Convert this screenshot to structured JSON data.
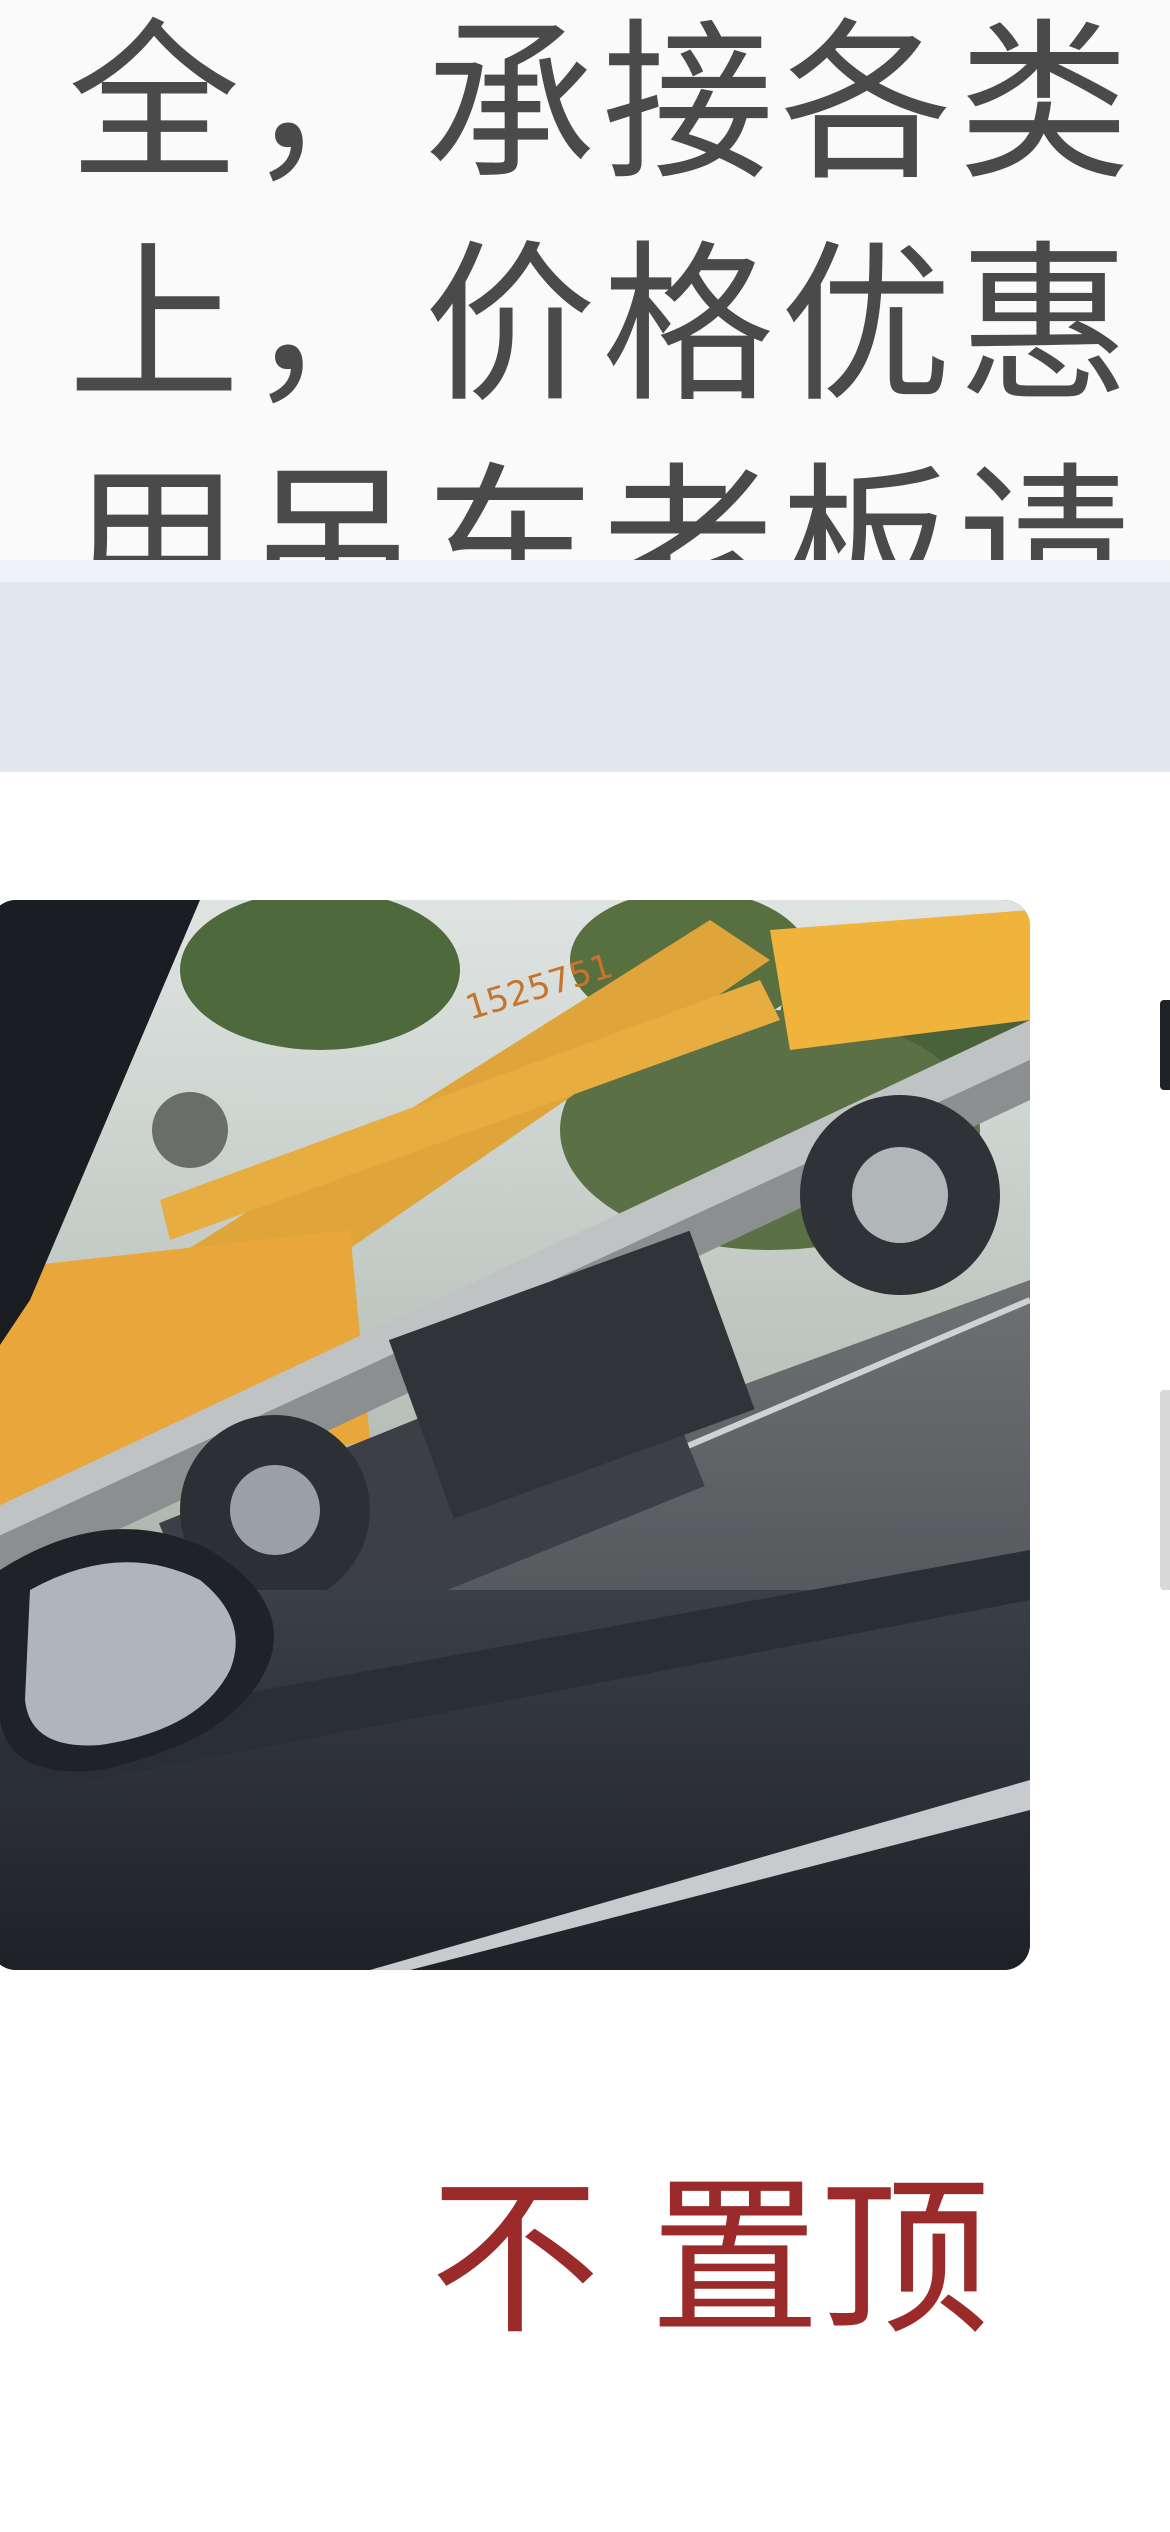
{
  "post": {
    "text_lines": [
      "全，承接各类",
      "上，价格优惠",
      "用吊车老板请"
    ]
  },
  "photo": {
    "icon": "crane-truck-photo",
    "alt": "",
    "truck_text": "1525751"
  },
  "actions": {
    "pin_arrow": "↑",
    "pin_label": "置顶",
    "pin_prefix": "不"
  },
  "colors": {
    "text": "#4a4a4a",
    "divider": "#e3e8f0",
    "pin": "#9b2a2a"
  }
}
